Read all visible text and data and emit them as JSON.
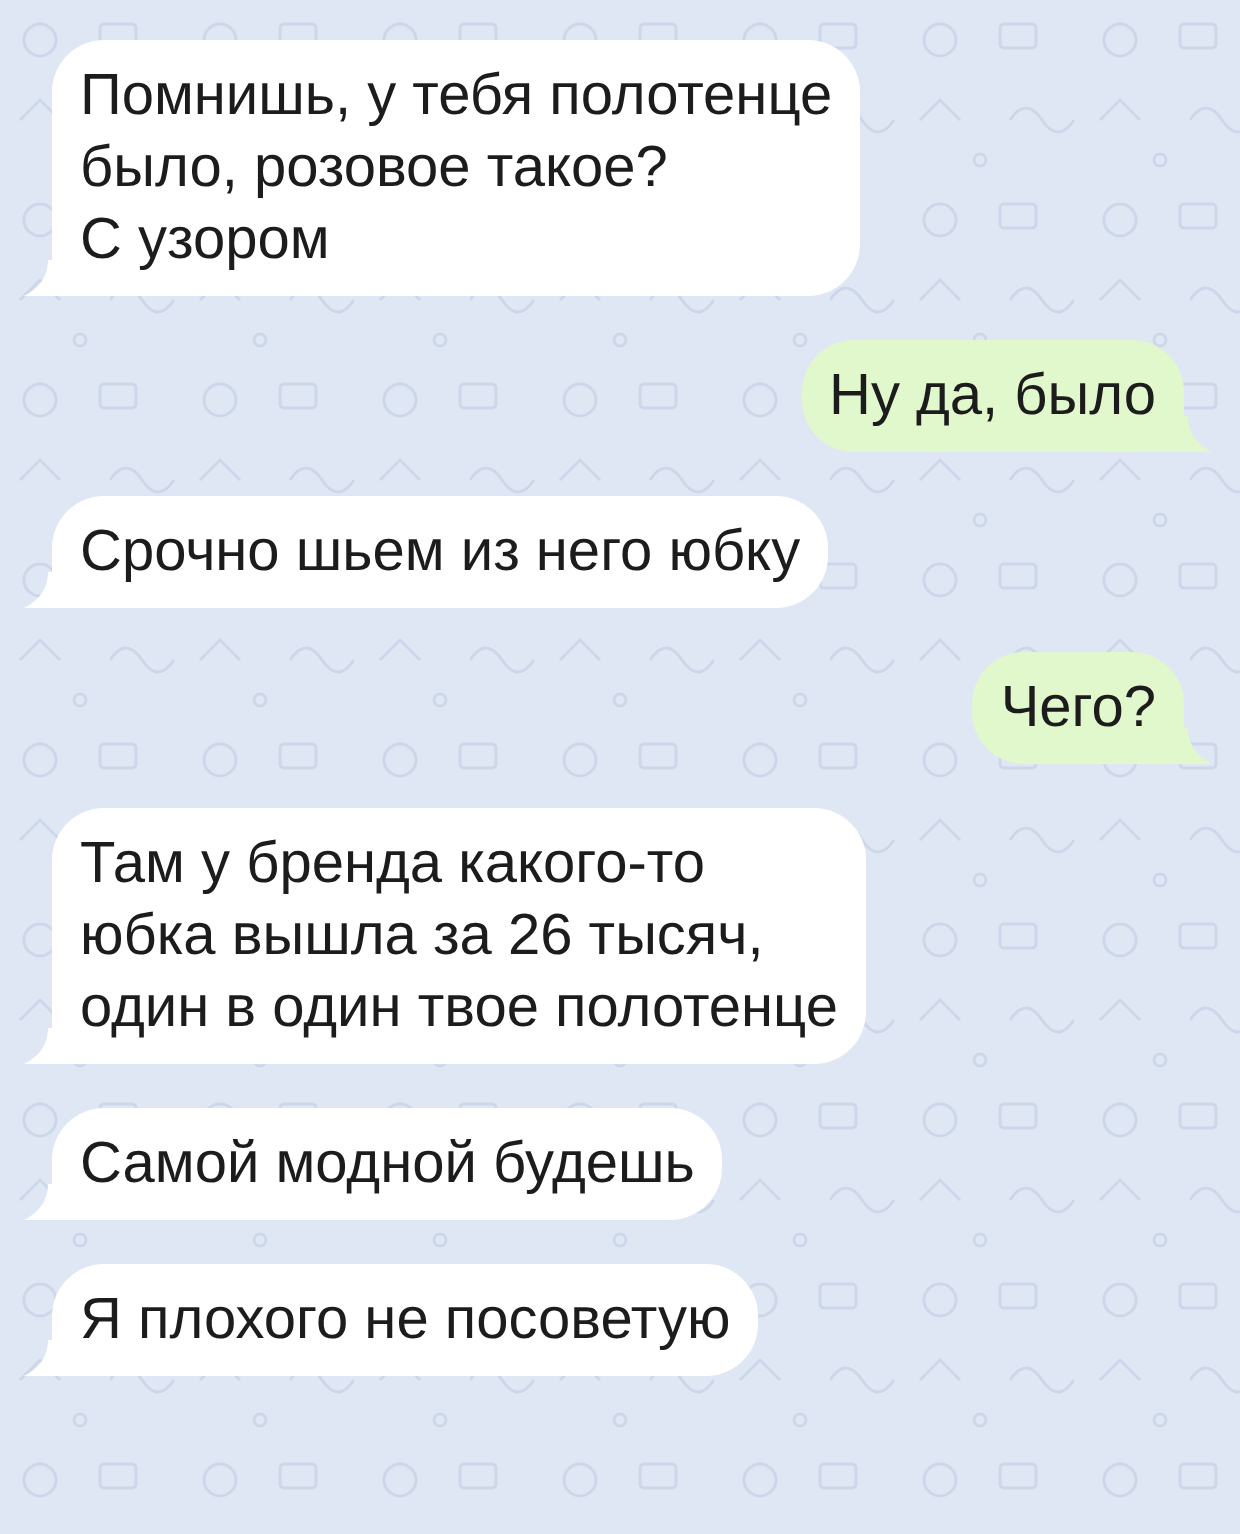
{
  "messages": [
    {
      "kind": "incoming",
      "text": "Помнишь, у тебя полотенце\nбыло, розовое такое?\nС узором"
    },
    {
      "kind": "outgoing",
      "text": "Ну да, было"
    },
    {
      "kind": "incoming",
      "text": "Срочно шьем из него юбку"
    },
    {
      "kind": "outgoing",
      "text": "Чего?"
    },
    {
      "kind": "incoming",
      "text": "Там у бренда какого-то\nюбка вышла за 26 тысяч,\nодин в один твое полотенце"
    },
    {
      "kind": "incoming",
      "text": "Самой модной будешь"
    },
    {
      "kind": "incoming",
      "text": "Я плохого не посоветую"
    }
  ]
}
